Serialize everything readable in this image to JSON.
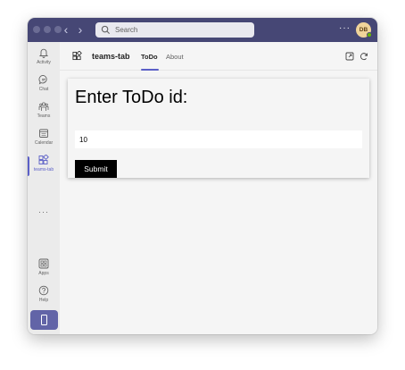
{
  "titlebar": {
    "search_placeholder": "Search",
    "more_label": "···",
    "avatar_initials": "DB"
  },
  "rail": {
    "items": [
      {
        "label": "Activity",
        "icon": "bell-icon"
      },
      {
        "label": "Chat",
        "icon": "chat-icon"
      },
      {
        "label": "Teams",
        "icon": "teams-icon"
      },
      {
        "label": "Calendar",
        "icon": "calendar-icon"
      },
      {
        "label": "teams-tab",
        "icon": "app-grid-icon",
        "active": true
      },
      {
        "label": "Apps",
        "icon": "apps-icon"
      },
      {
        "label": "Help",
        "icon": "help-icon"
      }
    ],
    "more_label": "···"
  },
  "header": {
    "app_name": "teams-tab",
    "tabs": [
      {
        "label": "ToDo",
        "active": true
      },
      {
        "label": "About",
        "active": false
      }
    ]
  },
  "form": {
    "heading": "Enter ToDo id:",
    "input_value": "10",
    "submit_label": "Submit"
  },
  "colors": {
    "titlebar": "#464775",
    "accent": "#5b5fc7",
    "rail_bg": "#ebebeb",
    "content_bg": "#f5f5f5",
    "button_bg": "#000000"
  }
}
